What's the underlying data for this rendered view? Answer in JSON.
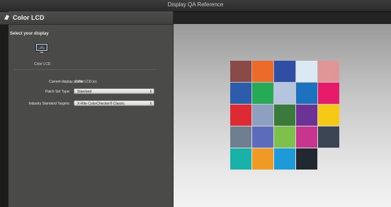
{
  "window": {
    "title": "Display QA Reference"
  },
  "header": {
    "label": "Color LCD"
  },
  "sidebar": {
    "select_label": "Select your display",
    "display_name": "Color LCD",
    "profile_label": "Current display profile:",
    "profile_value": "Color LCD.icc",
    "patch_set_label": "Patch Set Type:",
    "patch_set_value": "Standard",
    "targets_label": "Industry Standard Targets:",
    "targets_value": "X-Rite ColorChecker® Classic"
  },
  "chart_patches": [
    [
      "#8a4a48",
      "#ec6a2a",
      "#2e4fa4",
      "#dbe9f5",
      "#e09596"
    ],
    [
      "#2c5dab",
      "#27aa55",
      "#b5c5df",
      "#1d72c0",
      "#e81a6a"
    ],
    [
      "#de2a33",
      "#8da0bf",
      "#3a7a3b",
      "#6d3394",
      "#f6c914"
    ],
    [
      "#6f7f92",
      "#5c6cba",
      "#7dc04c",
      "#c6358e",
      "#3b4553"
    ],
    [
      "#1ab1a9",
      "#f09a26",
      "#1d9ad8",
      "#22282f"
    ]
  ]
}
